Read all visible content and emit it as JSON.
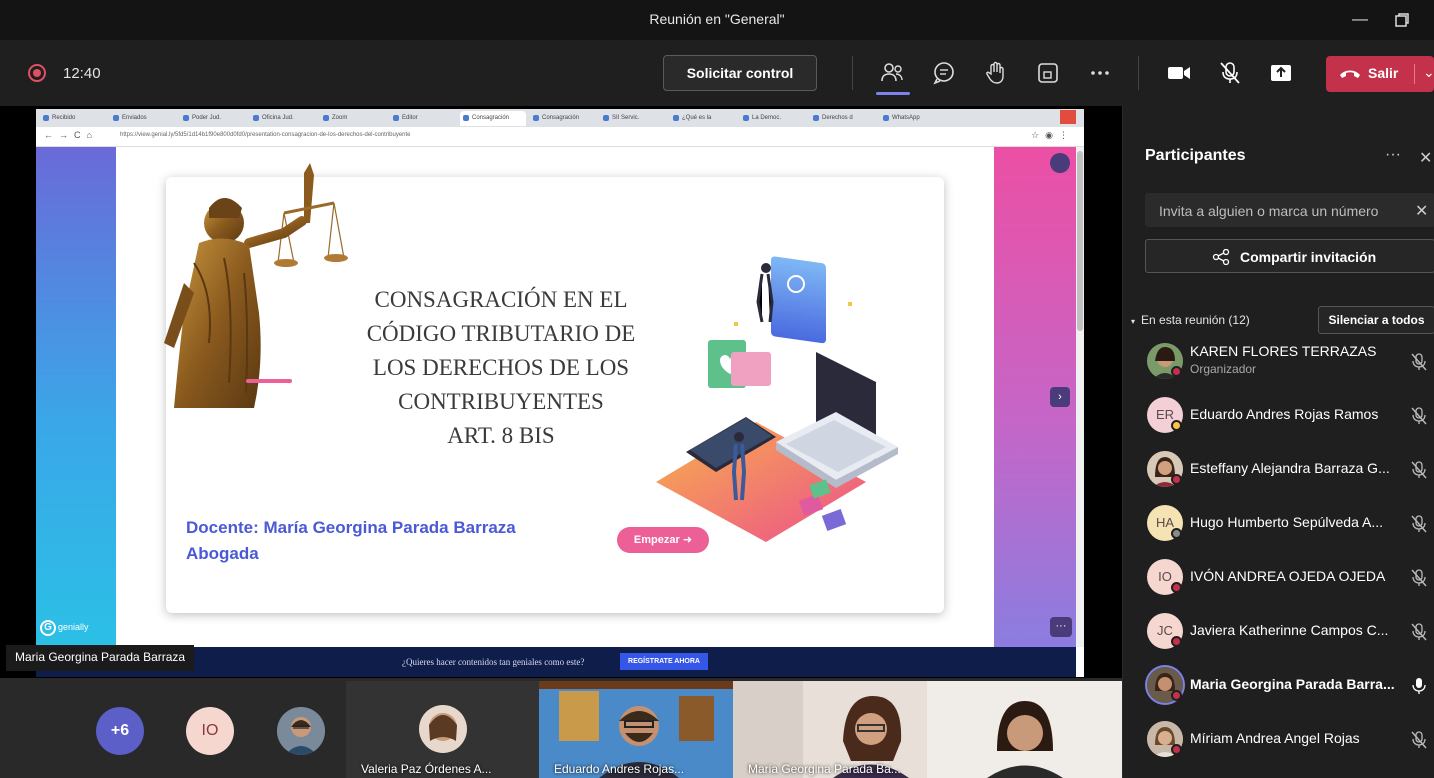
{
  "window": {
    "title": "Reunión en \"General\""
  },
  "toolbar": {
    "timer": "12:40",
    "request_control": "Solicitar control",
    "leave_label": "Salir",
    "icons": [
      "people-icon",
      "chat-icon",
      "raise-hand-icon",
      "rooms-icon",
      "more-icon",
      "camera-icon",
      "mic-muted-icon",
      "share-tray-icon"
    ]
  },
  "browser": {
    "tabs": [
      "Recibido",
      "Enviados",
      "Poder Jud.",
      "Oficina Jud.",
      "Zoom",
      "Editor",
      "Consagración",
      "Consagración",
      "SII Servic.",
      "¿Qué es la",
      "La Democ.",
      "Derechos d",
      "WhatsApp"
    ],
    "url": "https://view.genial.ly/5fd5/1d14b1f90e800d0fd0/presentation-consagracion-de-los-derechos-del-contribuyente"
  },
  "slide": {
    "title": "CONSAGRACIÓN EN EL\nCÓDIGO TRIBUTARIO DE\nLOS DERECHOS DE LOS\nCONTRIBUYENTES\nART. 8 BIS",
    "docente_line1": "Docente: María Georgina Parada Barraza",
    "docente_line2": "Abogada",
    "start_button": "Empezar",
    "logo": "genially",
    "promo_text": "¿Quieres hacer contenidos tan geniales como este?",
    "promo_button": "REGÍSTRATE AHORA"
  },
  "stage": {
    "presenter_name": "Maria Georgina Parada Barraza"
  },
  "gallery": {
    "more_count": "+6",
    "initials": "IO",
    "videos": [
      {
        "name": "Valeria Paz Órdenes A..."
      },
      {
        "name": "Eduardo Andres Rojas..."
      },
      {
        "name": "Maria Georgina Parada Ba..."
      },
      {
        "name": ""
      }
    ]
  },
  "panel": {
    "title": "Participantes",
    "invite_placeholder": "Invita a alguien o marca un número",
    "share_invitation": "Compartir invitación",
    "section_label": "En esta reunión (12)",
    "mute_all": "Silenciar a todos",
    "participants": [
      {
        "name": "KAREN FLORES TERRAZAS",
        "role": "Organizador",
        "initials": "",
        "avatar_color": "#6b5a4a",
        "status_color": "#c4314b",
        "mic": "muted"
      },
      {
        "name": "Eduardo Andres Rojas Ramos",
        "role": "",
        "initials": "ER",
        "avatar_color": "#f2d0d6",
        "status_color": "#f8c542",
        "mic": "muted"
      },
      {
        "name": "Esteffany Alejandra Barraza G...",
        "role": "",
        "initials": "",
        "avatar_color": "#8a6a5a",
        "status_color": "#c4314b",
        "mic": "muted"
      },
      {
        "name": "Hugo Humberto Sepúlveda A...",
        "role": "",
        "initials": "HA",
        "avatar_color": "#f6e3b4",
        "status_color": "#8a8a8a",
        "mic": "muted"
      },
      {
        "name": "IVÓN ANDREA OJEDA OJEDA",
        "role": "",
        "initials": "IO",
        "avatar_color": "#f6d7cf",
        "status_color": "#c4314b",
        "mic": "muted"
      },
      {
        "name": "Javiera Katherinne Campos C...",
        "role": "",
        "initials": "JC",
        "avatar_color": "#f6d7cf",
        "status_color": "#c4314b",
        "mic": "muted"
      },
      {
        "name": "Maria Georgina Parada Barra...",
        "role": "",
        "initials": "",
        "avatar_color": "#5a4a3a",
        "status_color": "#c4314b",
        "mic": "on"
      },
      {
        "name": "Míriam Andrea Angel Rojas",
        "role": "",
        "initials": "",
        "avatar_color": "#9a7a6a",
        "status_color": "#c4314b",
        "mic": "muted"
      }
    ]
  }
}
